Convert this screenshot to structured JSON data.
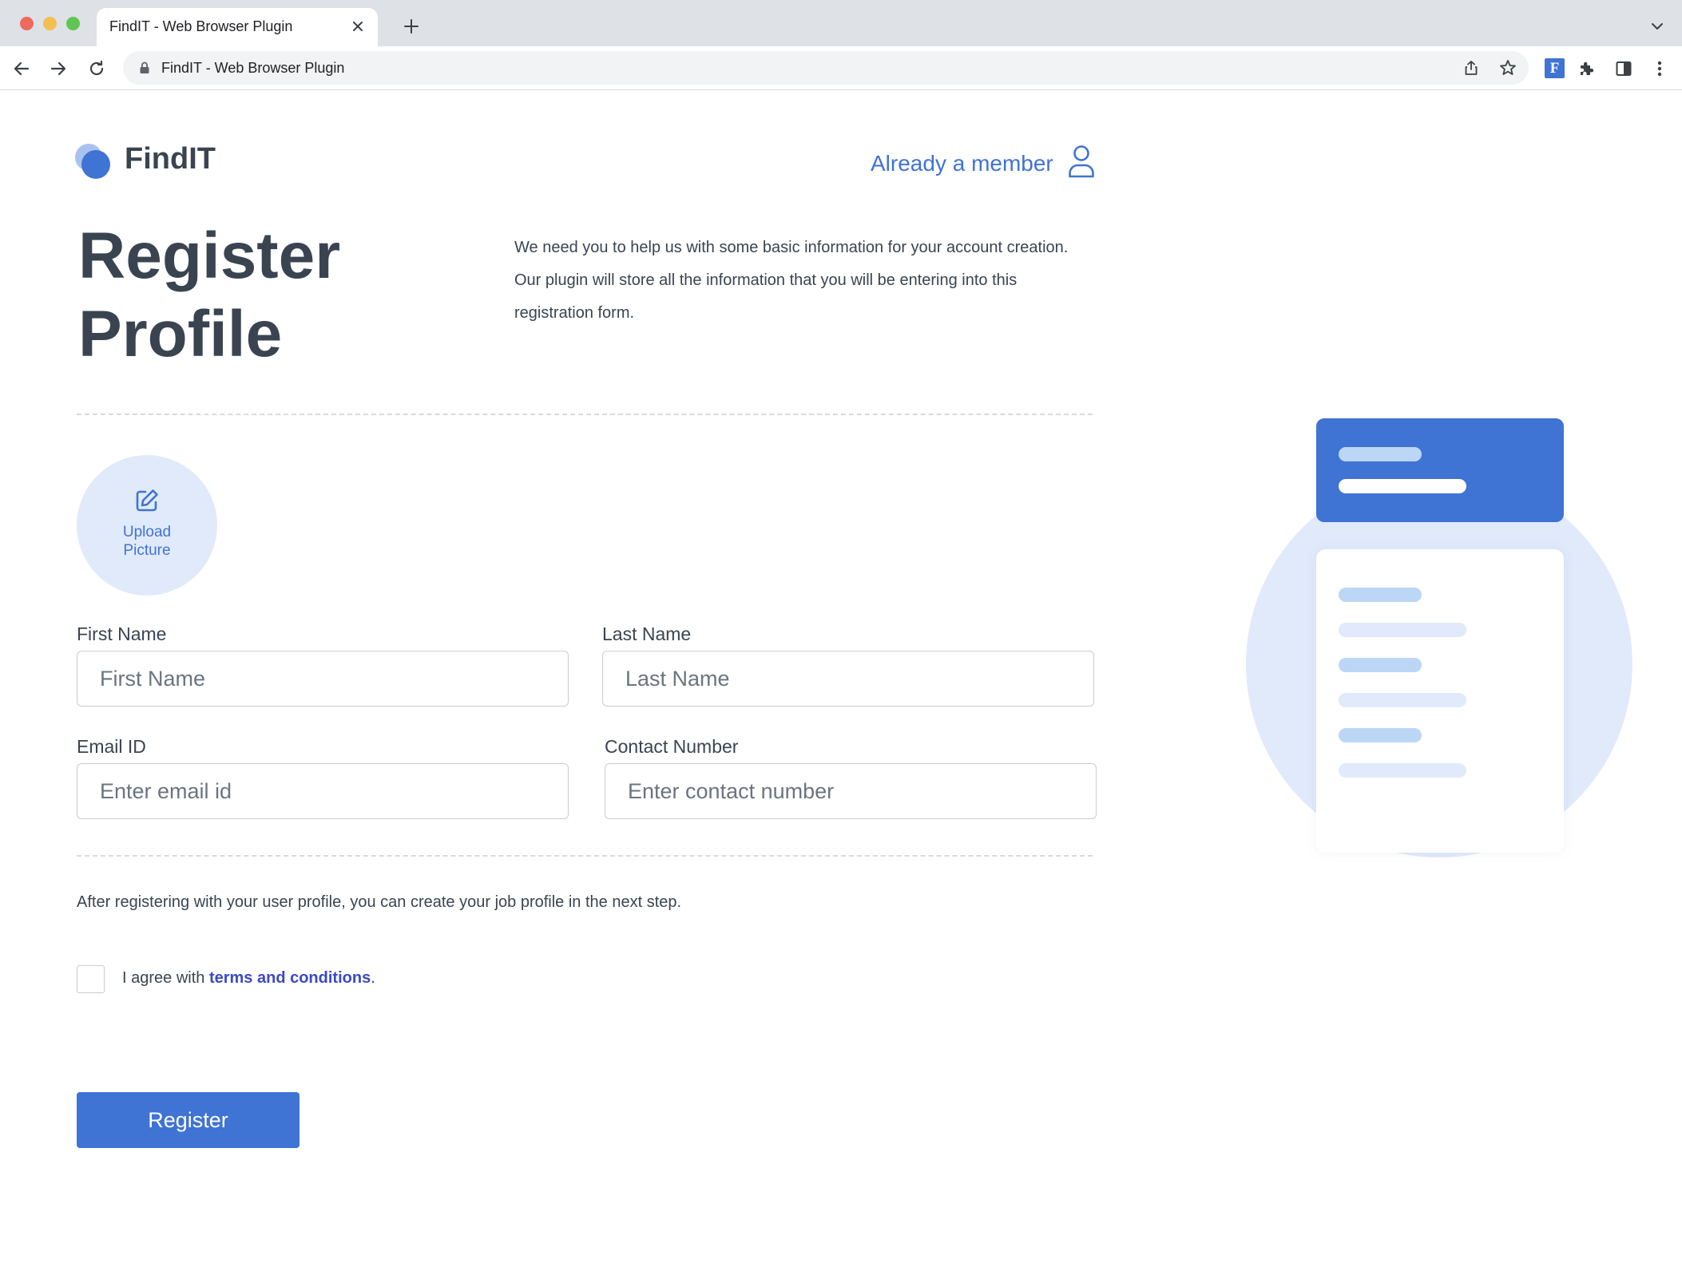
{
  "browser": {
    "tab_title": "FindIT - Web Browser Plugin",
    "url": "FindIT - Web Browser Plugin",
    "extension_letter": "F"
  },
  "header": {
    "brand": "FindIT",
    "member_link": "Already a member"
  },
  "main": {
    "title_line1": "Register",
    "title_line2": "Profile",
    "intro": "We need you to help us with some basic information for your account creation. Our plugin will store all the information that you will be entering into this registration form."
  },
  "upload": {
    "label_line1": "Upload",
    "label_line2": "Picture"
  },
  "form": {
    "first_name": {
      "label": "First Name",
      "placeholder": "First Name",
      "value": ""
    },
    "last_name": {
      "label": "Last Name",
      "placeholder": "Last Name",
      "value": ""
    },
    "email": {
      "label": "Email ID",
      "placeholder": "Enter email id",
      "value": ""
    },
    "contact": {
      "label": "Contact Number",
      "placeholder": "Enter contact number",
      "value": ""
    }
  },
  "note": "After registering with your user profile, you can create your job profile in the next step.",
  "agreement": {
    "prefix": "I agree with ",
    "link": "terms and conditions",
    "suffix": ".",
    "checked": false
  },
  "register_button": "Register",
  "colors": {
    "accent": "#3f73d4",
    "accent_light": "#e1eafb",
    "text": "#3a4451",
    "link": "#3b49c7"
  }
}
